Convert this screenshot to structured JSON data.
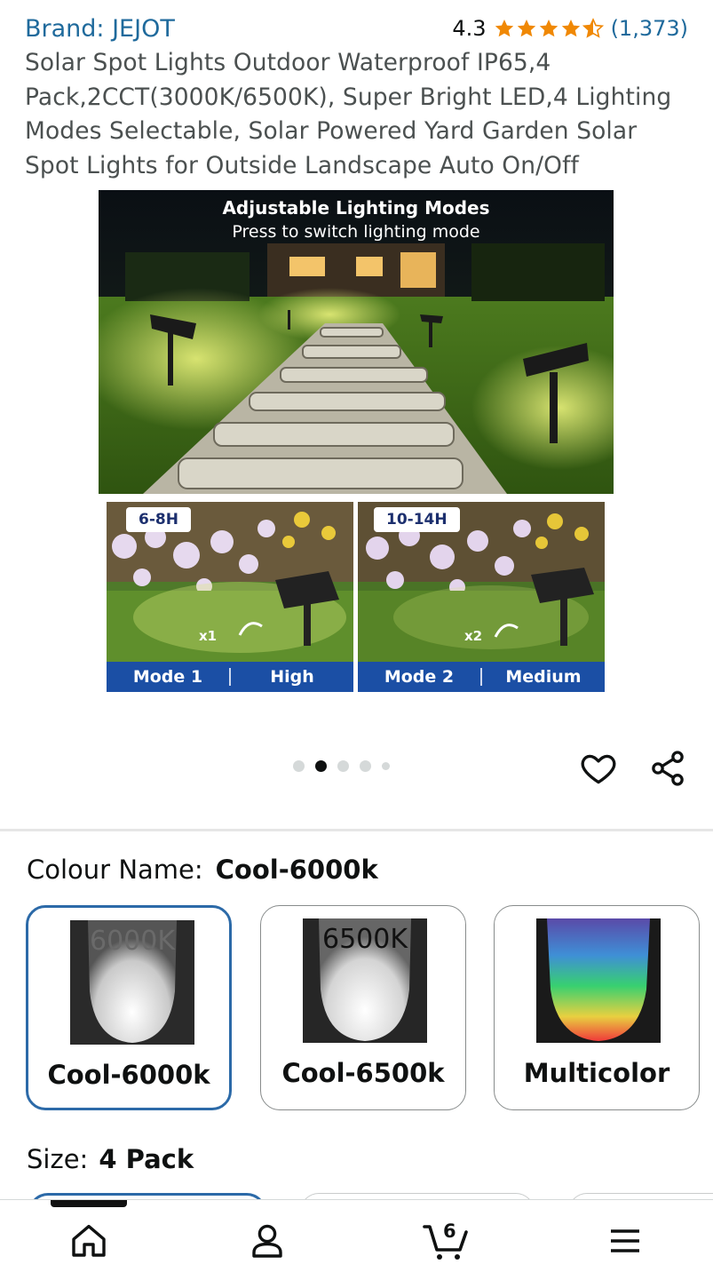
{
  "product": {
    "brand": "Brand: JEJOT",
    "rating_value": "4.3",
    "rating_fraction": 0.86,
    "rating_count": "(1,373)",
    "title": "Solar Spot Lights Outdoor Waterproof IP65,4 Pack,2CCT(3000K/6500K), Super Bright LED,4 Lighting Modes Selectable, Solar Powered Yard Garden Solar Spot Lights for Outside Landscape Auto On/Off"
  },
  "gallery": {
    "hero_title": "Adjustable Lighting Modes",
    "hero_subtitle": "Press to switch lighting mode",
    "modes": [
      {
        "hours": "6-8H",
        "taps": "x1",
        "mode": "Mode 1",
        "level": "High"
      },
      {
        "hours": "10-14H",
        "taps": "x2",
        "mode": "Mode 2",
        "level": "Medium"
      }
    ],
    "total_images": 5,
    "current_image": 2
  },
  "actions": {
    "favorite_icon": "heart-icon",
    "share_icon": "share-icon"
  },
  "colour": {
    "label": "Colour Name:",
    "selected": "Cool-6000k",
    "options": [
      {
        "thumb_label": "6000K",
        "name": "Cool-6000k"
      },
      {
        "thumb_label": "6500K",
        "name": "Cool-6500k"
      },
      {
        "thumb_label": "",
        "name": "Multicolor"
      }
    ]
  },
  "size": {
    "label": "Size:",
    "selected": "4 Pack"
  },
  "nav": {
    "items": [
      "home-icon",
      "account-icon",
      "cart-icon",
      "menu-icon"
    ],
    "cart_count": "6"
  },
  "colors": {
    "link": "#1f6a9c",
    "star": "#f08804",
    "selected_border": "#2c6aa8",
    "mode_bar": "#1b4fa5"
  }
}
